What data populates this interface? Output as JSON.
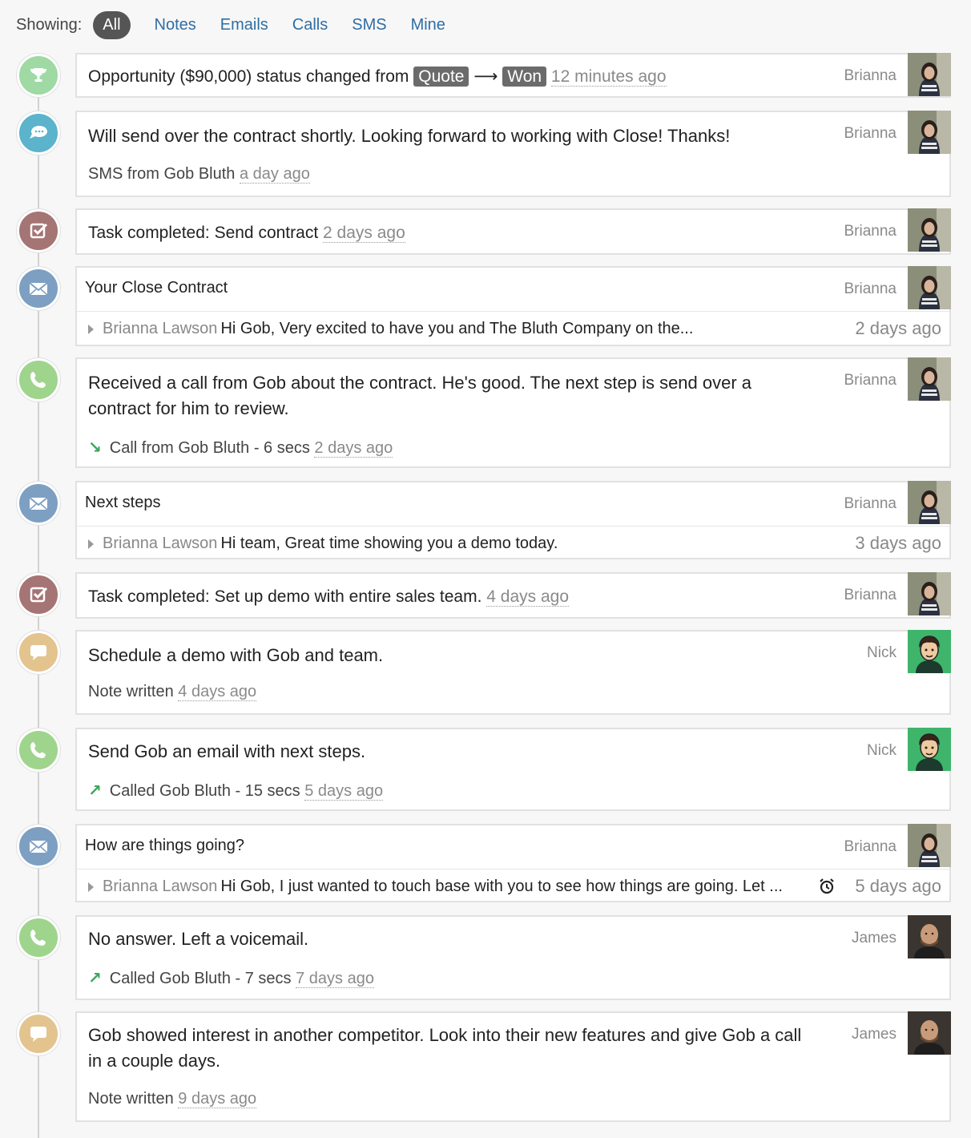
{
  "filter": {
    "label": "Showing:",
    "chips": [
      "All",
      "Notes",
      "Emails",
      "Calls",
      "SMS",
      "Mine"
    ],
    "active": "All"
  },
  "activities": [
    {
      "type": "opportunity",
      "text_prefix": "Opportunity ($90,000) status changed from",
      "from_status": "Quote",
      "arrow": "⟶",
      "to_status": "Won",
      "time": "12 minutes ago",
      "author": "Brianna"
    },
    {
      "type": "sms",
      "body": "Will send over the contract shortly. Looking forward to working with Close! Thanks!",
      "meta": "SMS from Gob Bluth",
      "time": "a day ago",
      "author": "Brianna"
    },
    {
      "type": "task",
      "text": "Task completed: Send contract",
      "time": "2 days ago",
      "author": "Brianna"
    },
    {
      "type": "email",
      "subject": "Your Close Contract",
      "from": "Brianna Lawson",
      "preview": "Hi Gob, Very excited to have you and The Bluth Company on the...",
      "time": "2 days ago",
      "author": "Brianna"
    },
    {
      "type": "call",
      "body_line1": "Received a call from Gob about the contract. He's good. The next step is send over a",
      "body_line2": "contract for him to review.",
      "direction_icon": "↘",
      "meta": "Call from Gob Bluth - 6 secs",
      "time": "2 days ago",
      "author": "Brianna"
    },
    {
      "type": "email",
      "subject": "Next steps",
      "from": "Brianna Lawson",
      "preview": "Hi team, Great time showing you a demo today.",
      "time": "3 days ago",
      "author": "Brianna"
    },
    {
      "type": "task",
      "text": "Task completed: Set up demo with entire sales team.",
      "time": "4 days ago",
      "author": "Brianna"
    },
    {
      "type": "note",
      "body": "Schedule a demo with Gob and team.",
      "meta": "Note written",
      "time": "4 days ago",
      "author": "Nick"
    },
    {
      "type": "call",
      "body": "Send Gob an email with next steps.",
      "direction_icon": "↗",
      "meta": "Called Gob Bluth - 15 secs",
      "time": "5 days ago",
      "author": "Nick"
    },
    {
      "type": "email",
      "subject": "How are things going?",
      "from": "Brianna Lawson",
      "preview": "Hi Gob, I just wanted to touch base with you to see how things are going. Let ...",
      "time": "5 days ago",
      "author": "Brianna",
      "alarm": true
    },
    {
      "type": "call",
      "body": "No answer. Left a voicemail.",
      "direction_icon": "↗",
      "meta": "Called Gob Bluth - 7 secs",
      "time": "7 days ago",
      "author": "James"
    },
    {
      "type": "note",
      "body_line1": "Gob showed interest in another competitor. Look into their new features and give Gob a call",
      "body_line2": "in a couple days.",
      "meta": "Note written",
      "time": "9 days ago",
      "author": "James"
    }
  ],
  "colors": {
    "trophy": "#9fd9a4",
    "sms": "#5bb3cc",
    "task": "#a57474",
    "email": "#7d9fc2",
    "call": "#9fd48d",
    "note": "#e3c48f",
    "link": "#2f6ea3"
  }
}
